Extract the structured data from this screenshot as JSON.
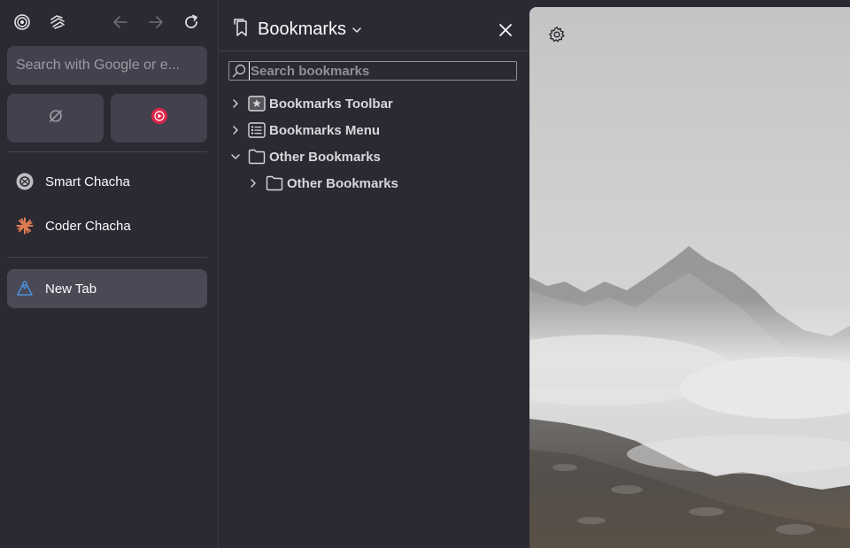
{
  "sidebar": {
    "toolbar": {
      "icons": [
        "firefox-view-icon",
        "chatbot-swirl-icon",
        "back-arrow-icon",
        "forward-arrow-icon",
        "reload-icon"
      ]
    },
    "urlbar": {
      "placeholder": "Search with Google or e..."
    },
    "pinned": [
      {
        "icon": "no-connection-icon"
      },
      {
        "icon": "youtube-music-icon",
        "color": "#e0244a"
      }
    ],
    "ai_items": [
      {
        "label": "Smart Chacha",
        "icon": "chatgpt-icon"
      },
      {
        "label": "Coder Chacha",
        "icon": "claude-icon",
        "color": "#e07b53"
      }
    ],
    "tabs": [
      {
        "label": "New Tab",
        "icon": "new-tab-icon",
        "selected": true
      }
    ]
  },
  "bookmarks_panel": {
    "title": "Bookmarks",
    "search_placeholder": "Search bookmarks",
    "tree": [
      {
        "label": "Bookmarks Toolbar",
        "icon": "bookmarks-toolbar-icon",
        "expanded": false,
        "level": 0
      },
      {
        "label": "Bookmarks Menu",
        "icon": "bookmarks-menu-icon",
        "expanded": false,
        "level": 0
      },
      {
        "label": "Other Bookmarks",
        "icon": "folder-icon",
        "expanded": true,
        "level": 0
      },
      {
        "label": "Other Bookmarks",
        "icon": "folder-icon",
        "expanded": false,
        "level": 1
      }
    ]
  },
  "content": {
    "settings_icon": "gear-icon"
  },
  "colors": {
    "sidebar_bg": "#2b2a33",
    "button_bg": "#42414d",
    "selected_tab": "#4a4955",
    "text": "#fbfbfe",
    "muted_text": "#9c9ba3"
  }
}
